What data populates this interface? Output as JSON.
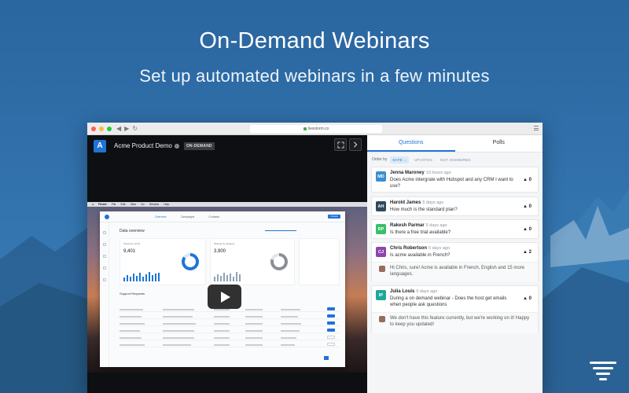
{
  "hero": {
    "title": "On-Demand Webinars",
    "subtitle": "Set up automated webinars in a few minutes"
  },
  "browser": {
    "url": "livestorm.co"
  },
  "video": {
    "logo_letter": "A",
    "title": "Acme Product Demo",
    "badge": "ON-DEMAND",
    "expand_icon": "expand-icon",
    "next_icon": "chevron-right-icon",
    "play_icon": "play-icon"
  },
  "panel": {
    "tabs": [
      {
        "label": "Questions",
        "active": true
      },
      {
        "label": "Polls",
        "active": false
      }
    ],
    "order_label": "Order by",
    "order_options": [
      {
        "label": "DATE ⌵",
        "active": true
      },
      {
        "label": "UPVOTES",
        "active": false
      },
      {
        "label": "NOT ANSWERED",
        "active": false
      }
    ],
    "questions": [
      {
        "initials": "MD",
        "color": "#3a8fd0",
        "name": "Jenna Maroney",
        "time": "19 hours ago",
        "text": "Does Acme intergrate with Hubspot and any CRM I want to use?",
        "votes": "▲ 0"
      },
      {
        "initials": "AH",
        "color": "#2f4a5e",
        "name": "Harold James",
        "time": "5 days ago",
        "text": "How much is the standard plan?",
        "votes": "▲ 0"
      },
      {
        "initials": "RP",
        "color": "#3bbf6a",
        "name": "Rakesh Parmar",
        "time": "5 days ago",
        "text": "Is there a free trial available?",
        "votes": "▲ 0"
      },
      {
        "initials": "CJ",
        "color": "#8e44ad",
        "name": "Chris Robertson",
        "time": "5 days ago",
        "text": "Is acme available in French?",
        "votes": "▲ 2",
        "answer": "Hi Chris, sure! Acme is available in French, English and 15 more languages."
      },
      {
        "initials": "IP",
        "color": "#1fa89a",
        "name": "Julia Louis",
        "time": "6 days ago",
        "text": "During a on demand webinar - Does the host get emails when people ask questions",
        "votes": "▲ 0",
        "answer": "We don't have this feature currently, but we're working on it! Happy to keep you updated!"
      }
    ]
  }
}
